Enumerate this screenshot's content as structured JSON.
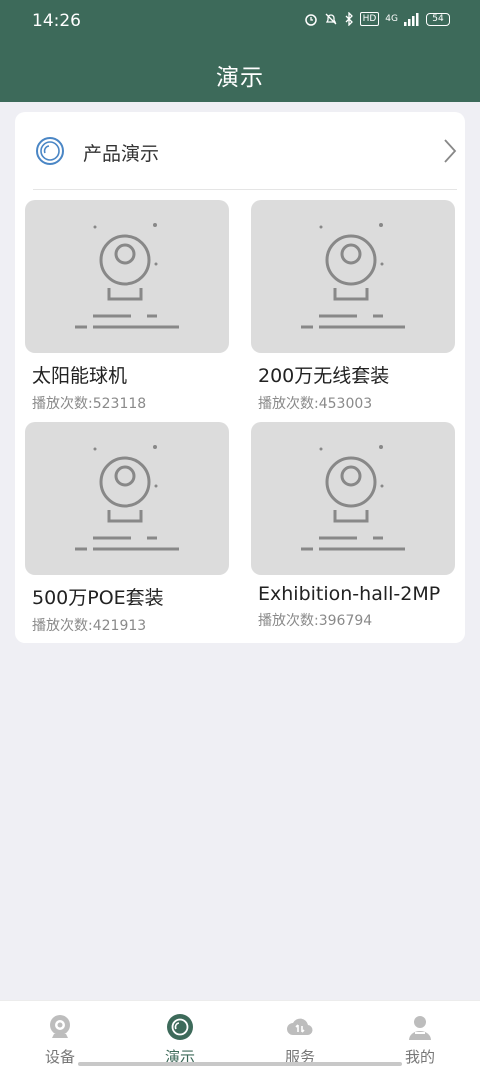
{
  "status_bar": {
    "time": "14:26",
    "network": "4G",
    "hd": "HD",
    "battery": "54"
  },
  "header": {
    "title": "演示"
  },
  "section": {
    "label": "产品演示"
  },
  "products": [
    {
      "title": "太阳能球机",
      "plays": "播放次数:523118"
    },
    {
      "title": "200万无线套装",
      "plays": "播放次数:453003"
    },
    {
      "title": "500万POE套装",
      "plays": "播放次数:421913"
    },
    {
      "title": "Exhibition-hall-2MP",
      "plays": "播放次数:396794"
    }
  ],
  "tabs": [
    {
      "label": "设备",
      "icon": "camera-icon"
    },
    {
      "label": "演示",
      "icon": "demo-icon",
      "active": true
    },
    {
      "label": "服务",
      "icon": "cloud-service-icon"
    },
    {
      "label": "我的",
      "icon": "user-icon"
    }
  ],
  "colors": {
    "brand": "#3d6a5a",
    "background": "#efeff4",
    "thumb": "#dcdcdc"
  }
}
